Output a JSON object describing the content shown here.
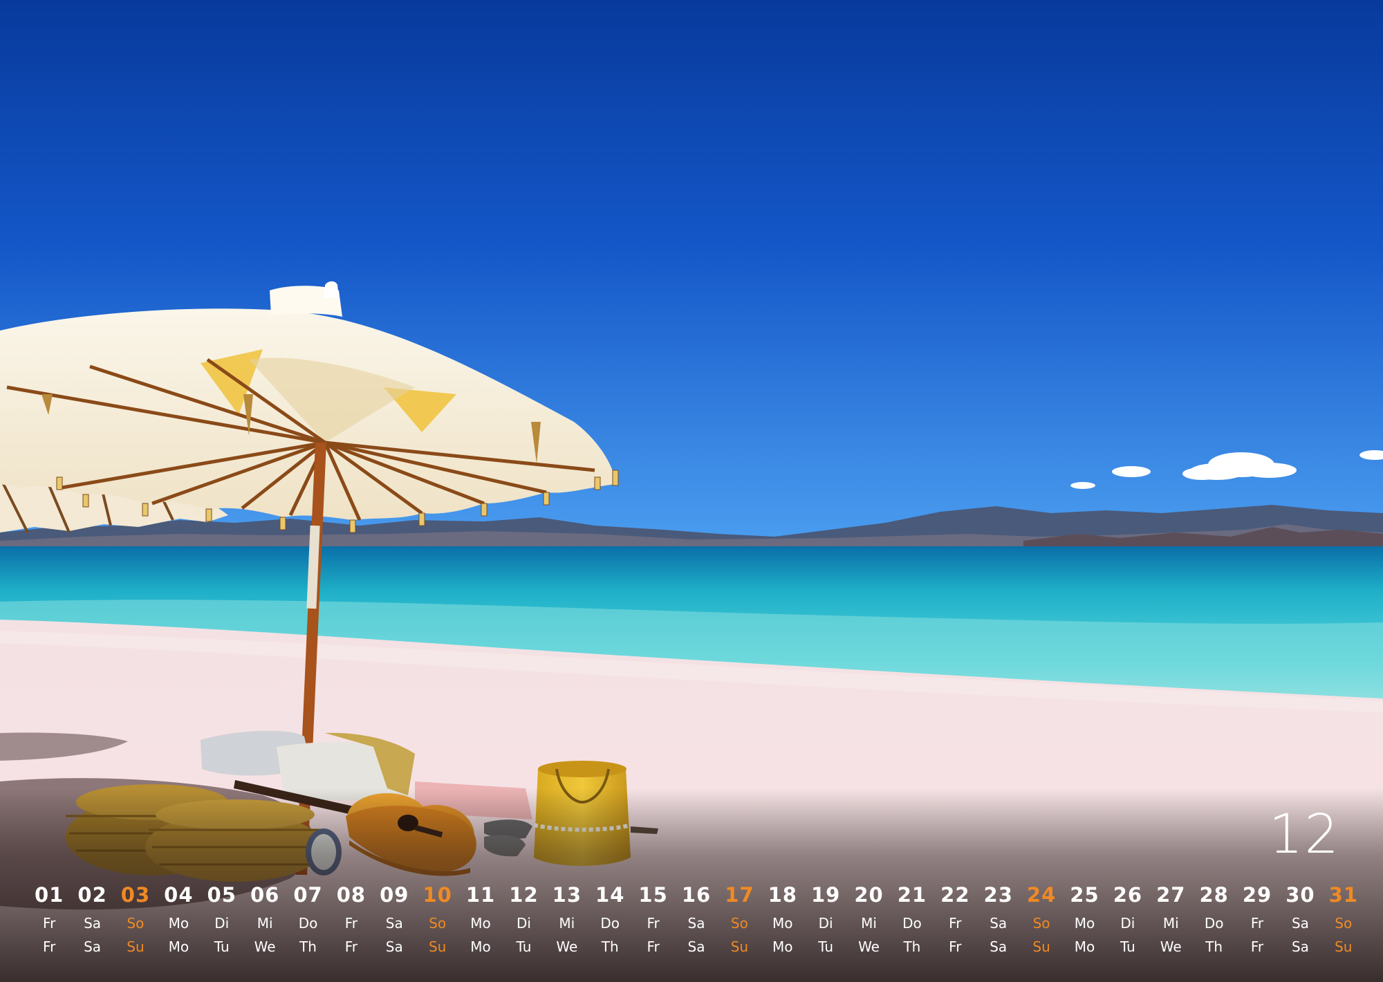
{
  "month_number": "12",
  "sunday_color": "#f08a24",
  "days": [
    {
      "num": "01",
      "de": "Fr",
      "en": "Fr",
      "sunday": false
    },
    {
      "num": "02",
      "de": "Sa",
      "en": "Sa",
      "sunday": false
    },
    {
      "num": "03",
      "de": "So",
      "en": "Su",
      "sunday": true
    },
    {
      "num": "04",
      "de": "Mo",
      "en": "Mo",
      "sunday": false
    },
    {
      "num": "05",
      "de": "Di",
      "en": "Tu",
      "sunday": false
    },
    {
      "num": "06",
      "de": "Mi",
      "en": "We",
      "sunday": false
    },
    {
      "num": "07",
      "de": "Do",
      "en": "Th",
      "sunday": false
    },
    {
      "num": "08",
      "de": "Fr",
      "en": "Fr",
      "sunday": false
    },
    {
      "num": "09",
      "de": "Sa",
      "en": "Sa",
      "sunday": false
    },
    {
      "num": "10",
      "de": "So",
      "en": "Su",
      "sunday": true
    },
    {
      "num": "11",
      "de": "Mo",
      "en": "Mo",
      "sunday": false
    },
    {
      "num": "12",
      "de": "Di",
      "en": "Tu",
      "sunday": false
    },
    {
      "num": "13",
      "de": "Mi",
      "en": "We",
      "sunday": false
    },
    {
      "num": "14",
      "de": "Do",
      "en": "Th",
      "sunday": false
    },
    {
      "num": "15",
      "de": "Fr",
      "en": "Fr",
      "sunday": false
    },
    {
      "num": "16",
      "de": "Sa",
      "en": "Sa",
      "sunday": false
    },
    {
      "num": "17",
      "de": "So",
      "en": "Su",
      "sunday": true
    },
    {
      "num": "18",
      "de": "Mo",
      "en": "Mo",
      "sunday": false
    },
    {
      "num": "19",
      "de": "Di",
      "en": "Tu",
      "sunday": false
    },
    {
      "num": "20",
      "de": "Mi",
      "en": "We",
      "sunday": false
    },
    {
      "num": "21",
      "de": "Do",
      "en": "Th",
      "sunday": false
    },
    {
      "num": "22",
      "de": "Fr",
      "en": "Fr",
      "sunday": false
    },
    {
      "num": "23",
      "de": "Sa",
      "en": "Sa",
      "sunday": false
    },
    {
      "num": "24",
      "de": "So",
      "en": "Su",
      "sunday": true
    },
    {
      "num": "25",
      "de": "Mo",
      "en": "Mo",
      "sunday": false
    },
    {
      "num": "26",
      "de": "Di",
      "en": "Tu",
      "sunday": false
    },
    {
      "num": "27",
      "de": "Mi",
      "en": "We",
      "sunday": false
    },
    {
      "num": "28",
      "de": "Do",
      "en": "Th",
      "sunday": false
    },
    {
      "num": "29",
      "de": "Fr",
      "en": "Fr",
      "sunday": false
    },
    {
      "num": "30",
      "de": "Sa",
      "en": "Sa",
      "sunday": false
    },
    {
      "num": "31",
      "de": "So",
      "en": "Su",
      "sunday": true
    }
  ]
}
